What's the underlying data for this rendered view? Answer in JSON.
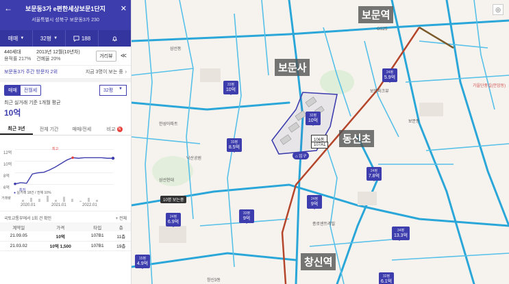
{
  "header": {
    "title": "보문동3가 e편한세상보문1단지",
    "address": "서울특별시 성북구 보문동3가 230",
    "tabs": [
      {
        "label": "매매"
      },
      {
        "label": "32평"
      },
      {
        "label": "188"
      }
    ]
  },
  "summary": {
    "households": "440세대",
    "floor_ratio": "용적률 217%",
    "built": "2013년 12월(10년차)",
    "coverage": "건폐율 20%",
    "review_label": "거리뷰"
  },
  "rank": {
    "left": "보문동3가 주간 방문자 2위",
    "right": "지금 3명이 보는 중"
  },
  "deal": {
    "toggle": [
      "매매",
      "전월세"
    ],
    "size": "32평",
    "avg_label": "최근 실거래 기준 1개월 평균",
    "avg_value": "10억"
  },
  "period_tabs": [
    "최근 3년",
    "전체 기간",
    "매매/전세",
    "비교"
  ],
  "chart_data": {
    "type": "line",
    "x": [
      "2020.01",
      "2021.01",
      "2022.01"
    ],
    "y_ticks": [
      "12억",
      "10억",
      "8억",
      "6억"
    ],
    "ylim": [
      5,
      13
    ],
    "series": [
      {
        "values": [
          6.1,
          6.3,
          6.2,
          7.8,
          8.0,
          8.1,
          8.5,
          9.0,
          9.6,
          10.2,
          10.6,
          10.5,
          10.6,
          10.6,
          10.6,
          10.6,
          10.5,
          10.5
        ]
      }
    ],
    "markers": {
      "high": "최고",
      "low": "최저"
    },
    "legend_text": "실거래 18건 / 전체 10%",
    "volume_label": "거래량"
  },
  "confirm": {
    "left": "국토교통부에서 1회 건 확인",
    "right": "+ 전체"
  },
  "table": {
    "headers": [
      "계약일",
      "가격",
      "타입",
      "층"
    ],
    "rows": [
      [
        "21.09.05",
        "10억",
        "107B1",
        "11층"
      ],
      [
        "21.03.02",
        "10억 1,500",
        "107B1",
        "19층"
      ]
    ]
  },
  "map": {
    "labels": {
      "bomun_station": "보문역",
      "bomunsa": "보문사",
      "dongshinco": "동신초",
      "changsin_station": "창신역"
    },
    "prices": [
      {
        "area": "33평",
        "value": "10억"
      },
      {
        "area": "32평",
        "value": "10억"
      },
      {
        "area": "33평",
        "value": "8.5억"
      },
      {
        "area": "24평",
        "value": "5.9억"
      },
      {
        "area": "24평",
        "value": "7.8억"
      },
      {
        "area": "24평",
        "value": "9억"
      },
      {
        "area": "33평",
        "value": "9억"
      },
      {
        "area": "24평",
        "value": "6.9억"
      },
      {
        "area": "15평",
        "value": "4.9억"
      },
      {
        "area": "34평",
        "value": "13.3억"
      },
      {
        "area": "32평",
        "value": "6.1억"
      }
    ],
    "place_labels": {
      "nearby_viewers": "10명 보는중",
      "building_no": "106동",
      "unit_no": "107A1",
      "entrance": "입구",
      "p1": "삼선동",
      "p2": "보문동",
      "p3": "창신3동",
      "p4": "가을단풍길(안암동)",
      "p5": "GS25",
      "p6": "보문파크뷰",
      "p7": "한성아파트",
      "p8": "삼선현대",
      "p9": "종로센트레빌",
      "p10": "낙산공원"
    }
  }
}
